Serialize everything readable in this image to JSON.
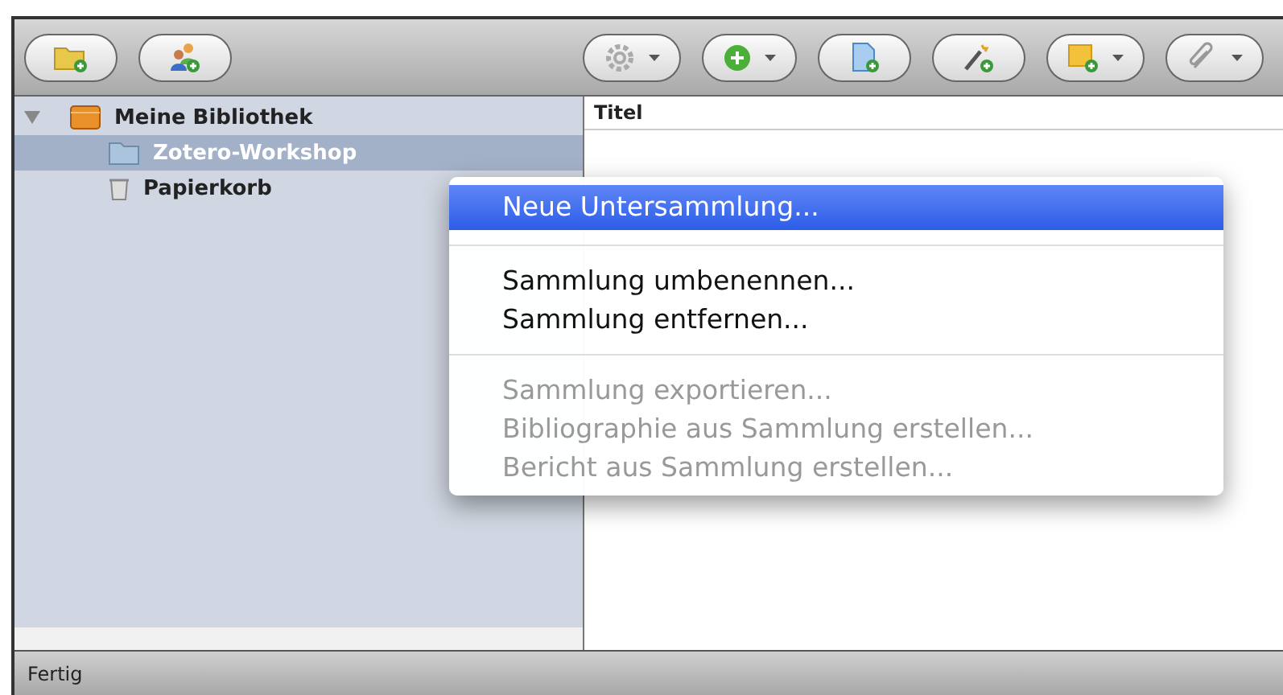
{
  "toolbar": {
    "left_buttons": [
      {
        "kind": "new-collection",
        "dropdown": false
      },
      {
        "kind": "new-group",
        "dropdown": false
      }
    ],
    "right_buttons": [
      {
        "kind": "actions",
        "dropdown": true
      },
      {
        "kind": "new-item",
        "dropdown": true
      },
      {
        "kind": "new-item-from-page",
        "dropdown": false
      },
      {
        "kind": "add-by-identifier",
        "dropdown": false
      },
      {
        "kind": "new-note",
        "dropdown": true
      },
      {
        "kind": "attachment",
        "dropdown": true
      }
    ]
  },
  "collections": [
    {
      "label": "Meine Bibliothek",
      "kind": "library",
      "expanded": true,
      "selected": false,
      "children": [
        {
          "label": "Zotero-Workshop",
          "kind": "folder",
          "selected": true
        },
        {
          "label": "Papierkorb",
          "kind": "trash",
          "selected": false
        }
      ]
    }
  ],
  "items_table": {
    "columns": [
      "Titel"
    ]
  },
  "context_menu": [
    {
      "kind": "item",
      "label": "Neue Untersammlung...",
      "selected": true,
      "disabled": false
    },
    {
      "kind": "separator"
    },
    {
      "kind": "item",
      "label": "Sammlung umbenennen...",
      "selected": false,
      "disabled": false
    },
    {
      "kind": "item",
      "label": "Sammlung entfernen...",
      "selected": false,
      "disabled": false
    },
    {
      "kind": "separator"
    },
    {
      "kind": "item",
      "label": "Sammlung exportieren...",
      "selected": false,
      "disabled": true
    },
    {
      "kind": "item",
      "label": "Bibliographie aus Sammlung erstellen...",
      "selected": false,
      "disabled": true
    },
    {
      "kind": "item",
      "label": "Bericht aus Sammlung erstellen...",
      "selected": false,
      "disabled": true
    }
  ],
  "status_bar": {
    "text": "Fertig"
  }
}
